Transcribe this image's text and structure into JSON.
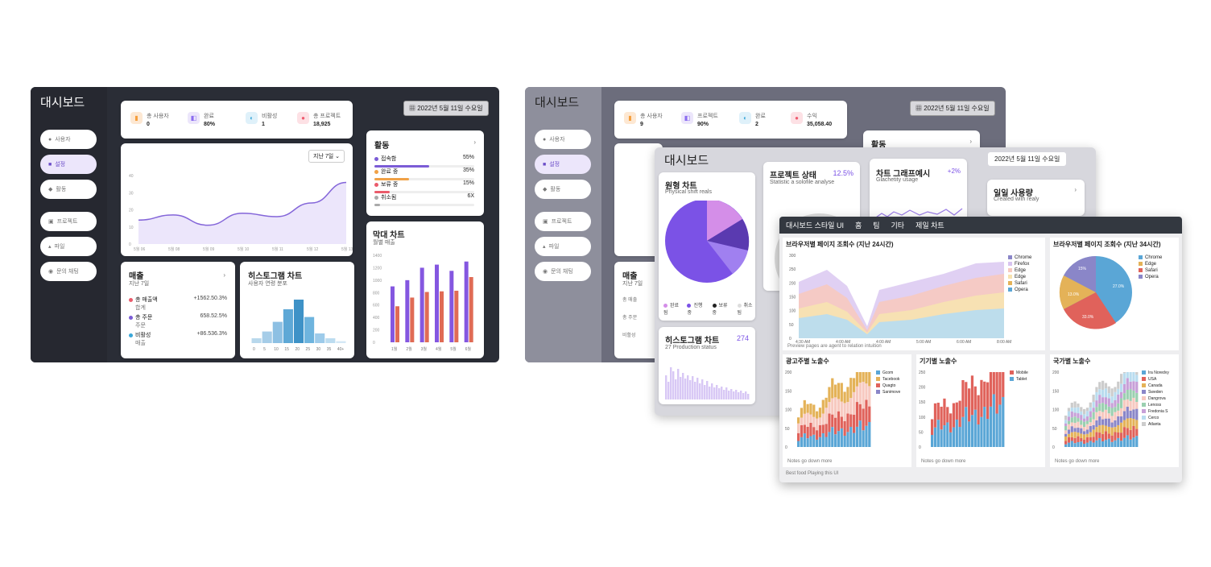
{
  "d1": {
    "title": "대시보드",
    "nav": [
      "사용자",
      "설정",
      "활동",
      "프로젝트",
      "파일",
      "문의 채팅"
    ],
    "stats": [
      {
        "label": "총 사용자",
        "value": "0",
        "icon": "user-icon",
        "color": "#f59e3b"
      },
      {
        "label": "완료",
        "value": "80%",
        "icon": "check-icon",
        "color": "#8b6cf0"
      },
      {
        "label": "비활성",
        "value": "1",
        "icon": "moon-icon",
        "color": "#3aa7d9"
      },
      {
        "label": "총 프로젝트",
        "value": "18,925",
        "icon": "folder-icon",
        "color": "#ef5b6f"
      }
    ],
    "date": "2022년 5월 11일 수요일",
    "range": "지난 7일",
    "y_ticks": [
      "40",
      "30",
      "20",
      "10",
      "0"
    ],
    "x_ticks": [
      "5월 06",
      "5월 08",
      "5월 09",
      "5월 10",
      "5월 11",
      "5월 12",
      "5월 13"
    ],
    "activity": {
      "title": "활동",
      "items": [
        {
          "label": "접속함",
          "pct": "55%",
          "value": 55,
          "color": "#7b5cd6"
        },
        {
          "label": "완료 중",
          "pct": "35%",
          "value": 35,
          "color": "#f0a146"
        },
        {
          "label": "보류 중",
          "pct": "15%",
          "value": 15,
          "color": "#ea5b6b"
        },
        {
          "label": "취소됨",
          "pct": "6X",
          "value": 6,
          "color": "#aaaaaa"
        }
      ]
    },
    "sales": {
      "title": "매출",
      "subtitle": "지난 7일",
      "rows": [
        {
          "name": "총 매출액",
          "sub": "합계",
          "value": "+1562.50.3%",
          "color": "#ea5b6b"
        },
        {
          "name": "총 주문",
          "sub": "주문",
          "value": "658.52.5%",
          "color": "#7b5cd6"
        },
        {
          "name": "비활성",
          "sub": "매출",
          "value": "+86.536.3%",
          "color": "#3aa7d9"
        }
      ]
    },
    "histogram": {
      "title": "히스토그램 차트",
      "subtitle": "사용자 연령 분포",
      "x_ticks": [
        "0",
        "5",
        "10",
        "15",
        "20",
        "25",
        "30",
        "35",
        "40+"
      ]
    },
    "barchart": {
      "title": "막대 차트",
      "subtitle": "월별 매출",
      "y_ticks": [
        "1400",
        "1200",
        "1000",
        "800",
        "600",
        "400",
        "200",
        "0"
      ],
      "x_ticks": [
        "1월",
        "2월",
        "3월",
        "4월",
        "5월",
        "6월"
      ]
    }
  },
  "d2": {
    "title": "대시보드",
    "nav": [
      "사용자",
      "설정",
      "활동",
      "프로젝트",
      "파일",
      "문의 채팅"
    ],
    "stats": [
      {
        "label": "총 사용자",
        "value": "9",
        "icon": "user-icon",
        "color": "#f59e3b"
      },
      {
        "label": "프로젝트",
        "value": "90%",
        "icon": "check-icon",
        "color": "#8b6cf0"
      },
      {
        "label": "완료",
        "value": "2",
        "icon": "moon-icon",
        "color": "#3aa7d9"
      },
      {
        "label": "수익",
        "value": "35,058.40",
        "icon": "folder-icon",
        "color": "#ef5b6f"
      }
    ],
    "date": "2022년 5월 11일 수요일",
    "activity_title": "활동",
    "sales_title": "매출",
    "sales_sub": "지난 7일",
    "rows": [
      "총 매출",
      "총 주문",
      "비활성"
    ]
  },
  "d3": {
    "title": "대시보드",
    "date": "2022년 5월 11일 수요일",
    "pie": {
      "title": "원형 차트",
      "subtitle": "Physical shift reals",
      "legend": [
        "완료됨",
        "진행 중",
        "보류 중",
        "취소됨"
      ]
    },
    "project": {
      "title": "프로젝트 상태",
      "pct": "12.5%",
      "subtitle": "Statistic a solofile analyse"
    },
    "line": {
      "title": "차트 그래프예시",
      "pct": "+2%",
      "subtitle": "Glachetity usage"
    },
    "usage": {
      "title": "일일 사용량",
      "subtitle": "Created with realy"
    },
    "hist": {
      "title": "히스토그램 차트",
      "value": "274",
      "subtitle": "27 Production status"
    }
  },
  "d4": {
    "title": "대시보드 스타일 UI",
    "menu": [
      "홈",
      "팀",
      "기타",
      "제일 차트"
    ],
    "area": {
      "title": "브라우저별 페이지 조회수 (지난 24시간)",
      "y_ticks": [
        "300",
        "250",
        "200",
        "150",
        "100",
        "50",
        "0"
      ],
      "x_ticks": [
        "4:30 AM",
        "4:00 AM",
        "4:00 AM",
        "5:00 AM",
        "6:00 AM",
        "8:00 AM"
      ],
      "legend": [
        "Chrome",
        "Firefox",
        "Edge",
        "Edge",
        "Safari",
        "Opera"
      ],
      "note": "Preview pages are agent to relation intuition"
    },
    "pie": {
      "title": "브라우저별 페이지 조회수 (지난 34시간)",
      "legend": [
        "Chrome",
        "Edge",
        "Safari",
        "Opera"
      ],
      "labels": [
        "15%",
        "13.0%",
        "33.0%",
        "27.0%"
      ]
    },
    "small": [
      {
        "title": "광고주별 노출수",
        "y_ticks": [
          "200",
          "150",
          "100",
          "50",
          "0"
        ],
        "legend": [
          "Gcom",
          "Tacebook",
          "Quagto",
          "Sanimove"
        ],
        "note": "Notes go down more"
      },
      {
        "title": "기기별 노출수",
        "y_ticks": [
          "250",
          "200",
          "150",
          "100",
          "50",
          "0"
        ],
        "legend": [
          "Mobile",
          "Tablet"
        ],
        "note": "Notes go down more"
      },
      {
        "title": "국가별 노출수",
        "y_ticks": [
          "200",
          "150",
          "100",
          "50",
          "0"
        ],
        "legend": [
          "Ira Noredvy",
          "USA",
          "Canada",
          "Sweden",
          "Dangrova",
          "Lenoss",
          "Fredonia S",
          "Cerco",
          "Atlanta"
        ],
        "note": "Notes go down more"
      }
    ],
    "footer": "Best food Playing this UI"
  },
  "chart_data": [
    {
      "type": "area",
      "title": "",
      "categories": [
        "5월 06",
        "5월 08",
        "5월 09",
        "5월 10",
        "5월 11",
        "5월 12",
        "5월 13"
      ],
      "values": [
        14,
        17,
        11,
        18,
        16,
        24,
        36
      ],
      "ylim": [
        0,
        40
      ]
    },
    {
      "type": "bar",
      "title": "히스토그램 차트",
      "categories": [
        "0",
        "5",
        "10",
        "15",
        "20",
        "25",
        "30",
        "35",
        "40+"
      ],
      "values": [
        5,
        12,
        22,
        35,
        45,
        27,
        10,
        5,
        2
      ]
    },
    {
      "type": "bar",
      "title": "막대 차트",
      "categories": [
        "1월",
        "2월",
        "3월",
        "4월",
        "5월",
        "6월"
      ],
      "series": [
        {
          "name": "",
          "values": [
            900,
            1000,
            1200,
            1250,
            1150,
            1300
          ]
        },
        {
          "name": "",
          "values": [
            580,
            720,
            810,
            820,
            830,
            1050
          ]
        }
      ],
      "ylim": [
        0,
        1400
      ]
    }
  ]
}
